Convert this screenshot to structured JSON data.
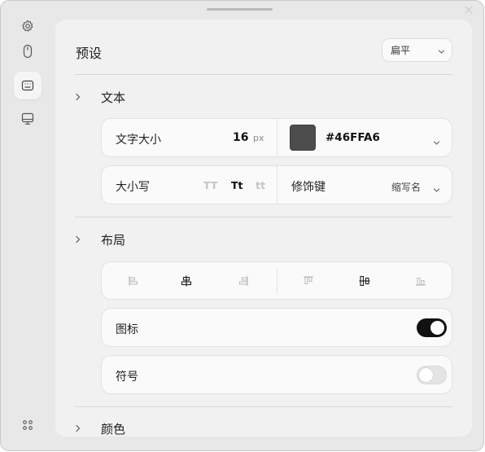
{
  "sidebar": {
    "items": [
      {
        "icon": "gear-icon"
      },
      {
        "icon": "mouse-icon"
      },
      {
        "icon": "keyboard-icon",
        "active": true
      },
      {
        "icon": "monitor-icon"
      }
    ],
    "bottom_icon": "apps-grid-icon"
  },
  "window": {
    "close_icon": "close-icon"
  },
  "preset": {
    "title": "预设",
    "selected": "扁平"
  },
  "sections": {
    "text": {
      "label": "文本"
    },
    "layout": {
      "label": "布局"
    },
    "color": {
      "label": "颜色"
    }
  },
  "text": {
    "font_size_label": "文字大小",
    "font_size_value": "16",
    "font_size_unit": "px",
    "color_hex": "#46FFA6",
    "case_label": "大小写",
    "case_options": [
      "TT",
      "Tt",
      "tt"
    ],
    "case_selected": "Tt",
    "modifier_label": "修饰键",
    "modifier_value": "缩写名"
  },
  "layout": {
    "horizontal_align_options": [
      "align-left-icon",
      "align-center-icon",
      "align-right-icon"
    ],
    "horizontal_selected": "align-center-icon",
    "vertical_align_options": [
      "align-top-icon",
      "align-middle-icon",
      "align-bottom-icon"
    ],
    "vertical_selected": "align-middle-icon",
    "icon_label": "图标",
    "icon_enabled": true,
    "symbol_label": "符号",
    "symbol_enabled": false
  },
  "colors": {
    "swatch": "#4d4d4d",
    "toggle_on": "#111111"
  }
}
